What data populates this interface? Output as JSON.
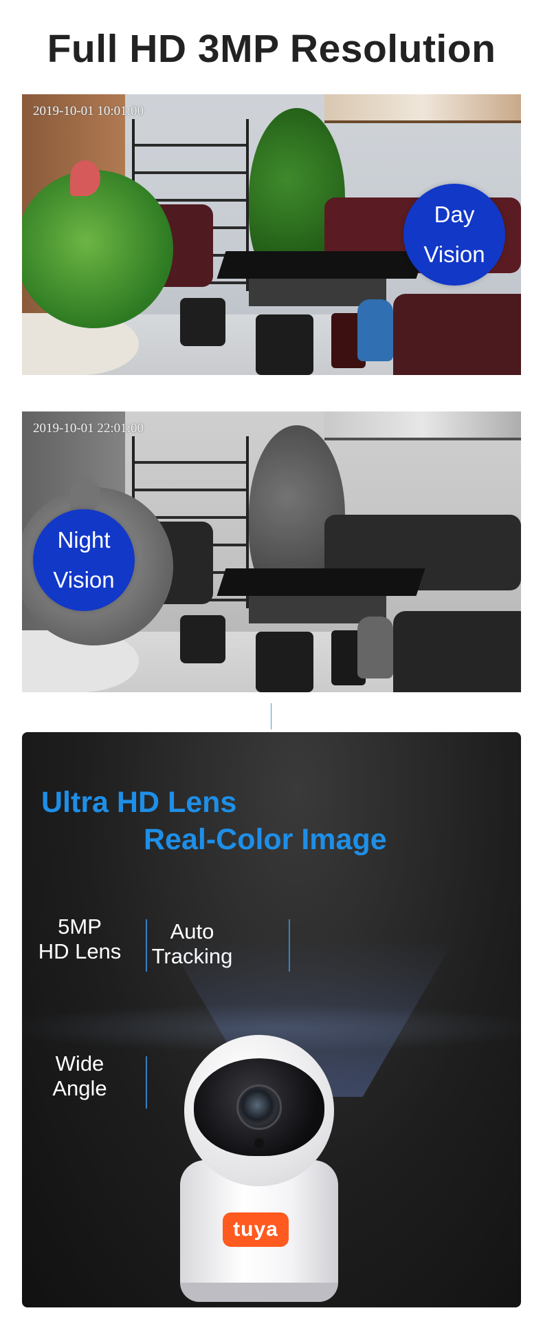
{
  "page_title": "Full HD 3MP Resolution",
  "day_photo": {
    "timestamp": "2019-10-01  10:01:00",
    "badge_line1": "Day",
    "badge_line2": "Vision"
  },
  "night_photo": {
    "timestamp": "2019-10-01  22:01:00",
    "badge_line1": "Night",
    "badge_line2": "Vision"
  },
  "lens_panel": {
    "headline_line1": "Ultra HD Lens",
    "headline_line2": "Real-Color Image",
    "features": [
      {
        "line1": "5MP",
        "line2": "HD Lens"
      },
      {
        "line1": "Auto",
        "line2": "Tracking"
      },
      {
        "line1": "Wide",
        "line2": "Angle"
      }
    ],
    "brand_logo": "tuya"
  },
  "colors": {
    "badge_blue": "#1238c8",
    "headline_blue": "#1e8fe8",
    "tuya_orange": "#ff5a1f",
    "accent_line": "#3b7fc4"
  }
}
